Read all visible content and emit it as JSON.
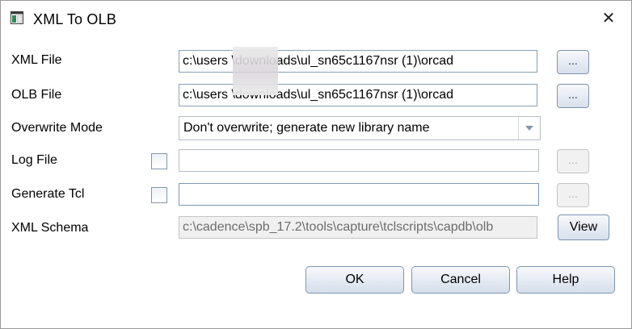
{
  "window": {
    "title": "XML To OLB",
    "close_glyph": "✕"
  },
  "form": {
    "xml_file": {
      "label": "XML File",
      "value": "c:\\users       \\downloads\\ul_sn65c1167nsr (1)\\orcad"
    },
    "olb_file": {
      "label": "OLB File",
      "value": "c:\\users       \\downloads\\ul_sn65c1167nsr (1)\\orcad"
    },
    "overwrite_mode": {
      "label": "Overwrite Mode",
      "value": "Don't overwrite; generate new library name"
    },
    "log_file": {
      "label": "Log File",
      "value": ""
    },
    "generate_tcl": {
      "label": "Generate Tcl",
      "value": ""
    },
    "xml_schema": {
      "label": "XML Schema",
      "value": "c:\\cadence\\spb_17.2\\tools\\capture\\tclscripts\\capdb\\olb"
    },
    "browse_label": "...",
    "view_label": "View"
  },
  "buttons": {
    "ok": "OK",
    "cancel": "Cancel",
    "help": "Help"
  },
  "colors": {
    "button_border": "#7f93b0",
    "disabled_bg": "#f0f0f0"
  }
}
